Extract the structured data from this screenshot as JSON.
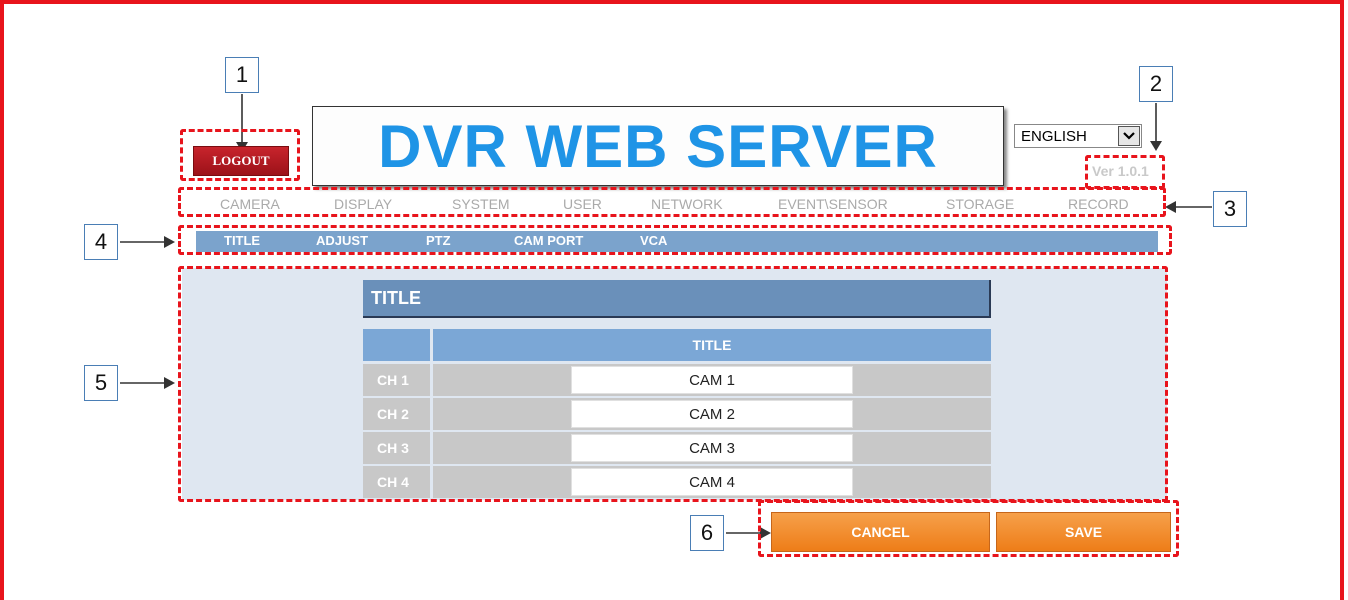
{
  "header": {
    "logout_label": "LOGOUT",
    "banner_title": "DVR WEB SERVER",
    "language": "ENGLISH",
    "version": "Ver 1.0.1"
  },
  "main_nav": [
    "CAMERA",
    "DISPLAY",
    "SYSTEM",
    "USER",
    "NETWORK",
    "EVENT\\SENSOR",
    "STORAGE",
    "RECORD"
  ],
  "sub_nav": [
    "TITLE",
    "ADJUST",
    "PTZ",
    "CAM PORT",
    "VCA"
  ],
  "panel": {
    "heading": "TITLE",
    "column_header": "TITLE",
    "rows": [
      {
        "channel": "CH 1",
        "title": "CAM 1"
      },
      {
        "channel": "CH 2",
        "title": "CAM 2"
      },
      {
        "channel": "CH 3",
        "title": "CAM 3"
      },
      {
        "channel": "CH 4",
        "title": "CAM 4"
      }
    ]
  },
  "actions": {
    "cancel_label": "CANCEL",
    "save_label": "SAVE"
  },
  "callouts": [
    "1",
    "2",
    "3",
    "4",
    "5",
    "6"
  ],
  "colors": {
    "annotation_red": "#e8141c",
    "banner_blue": "#1f94e6",
    "subnav_blue": "#7ba3cc",
    "button_orange": "#ee7d18",
    "logout_red": "#b01820"
  },
  "icons": {
    "language_dropdown": "chevron-down-icon"
  }
}
